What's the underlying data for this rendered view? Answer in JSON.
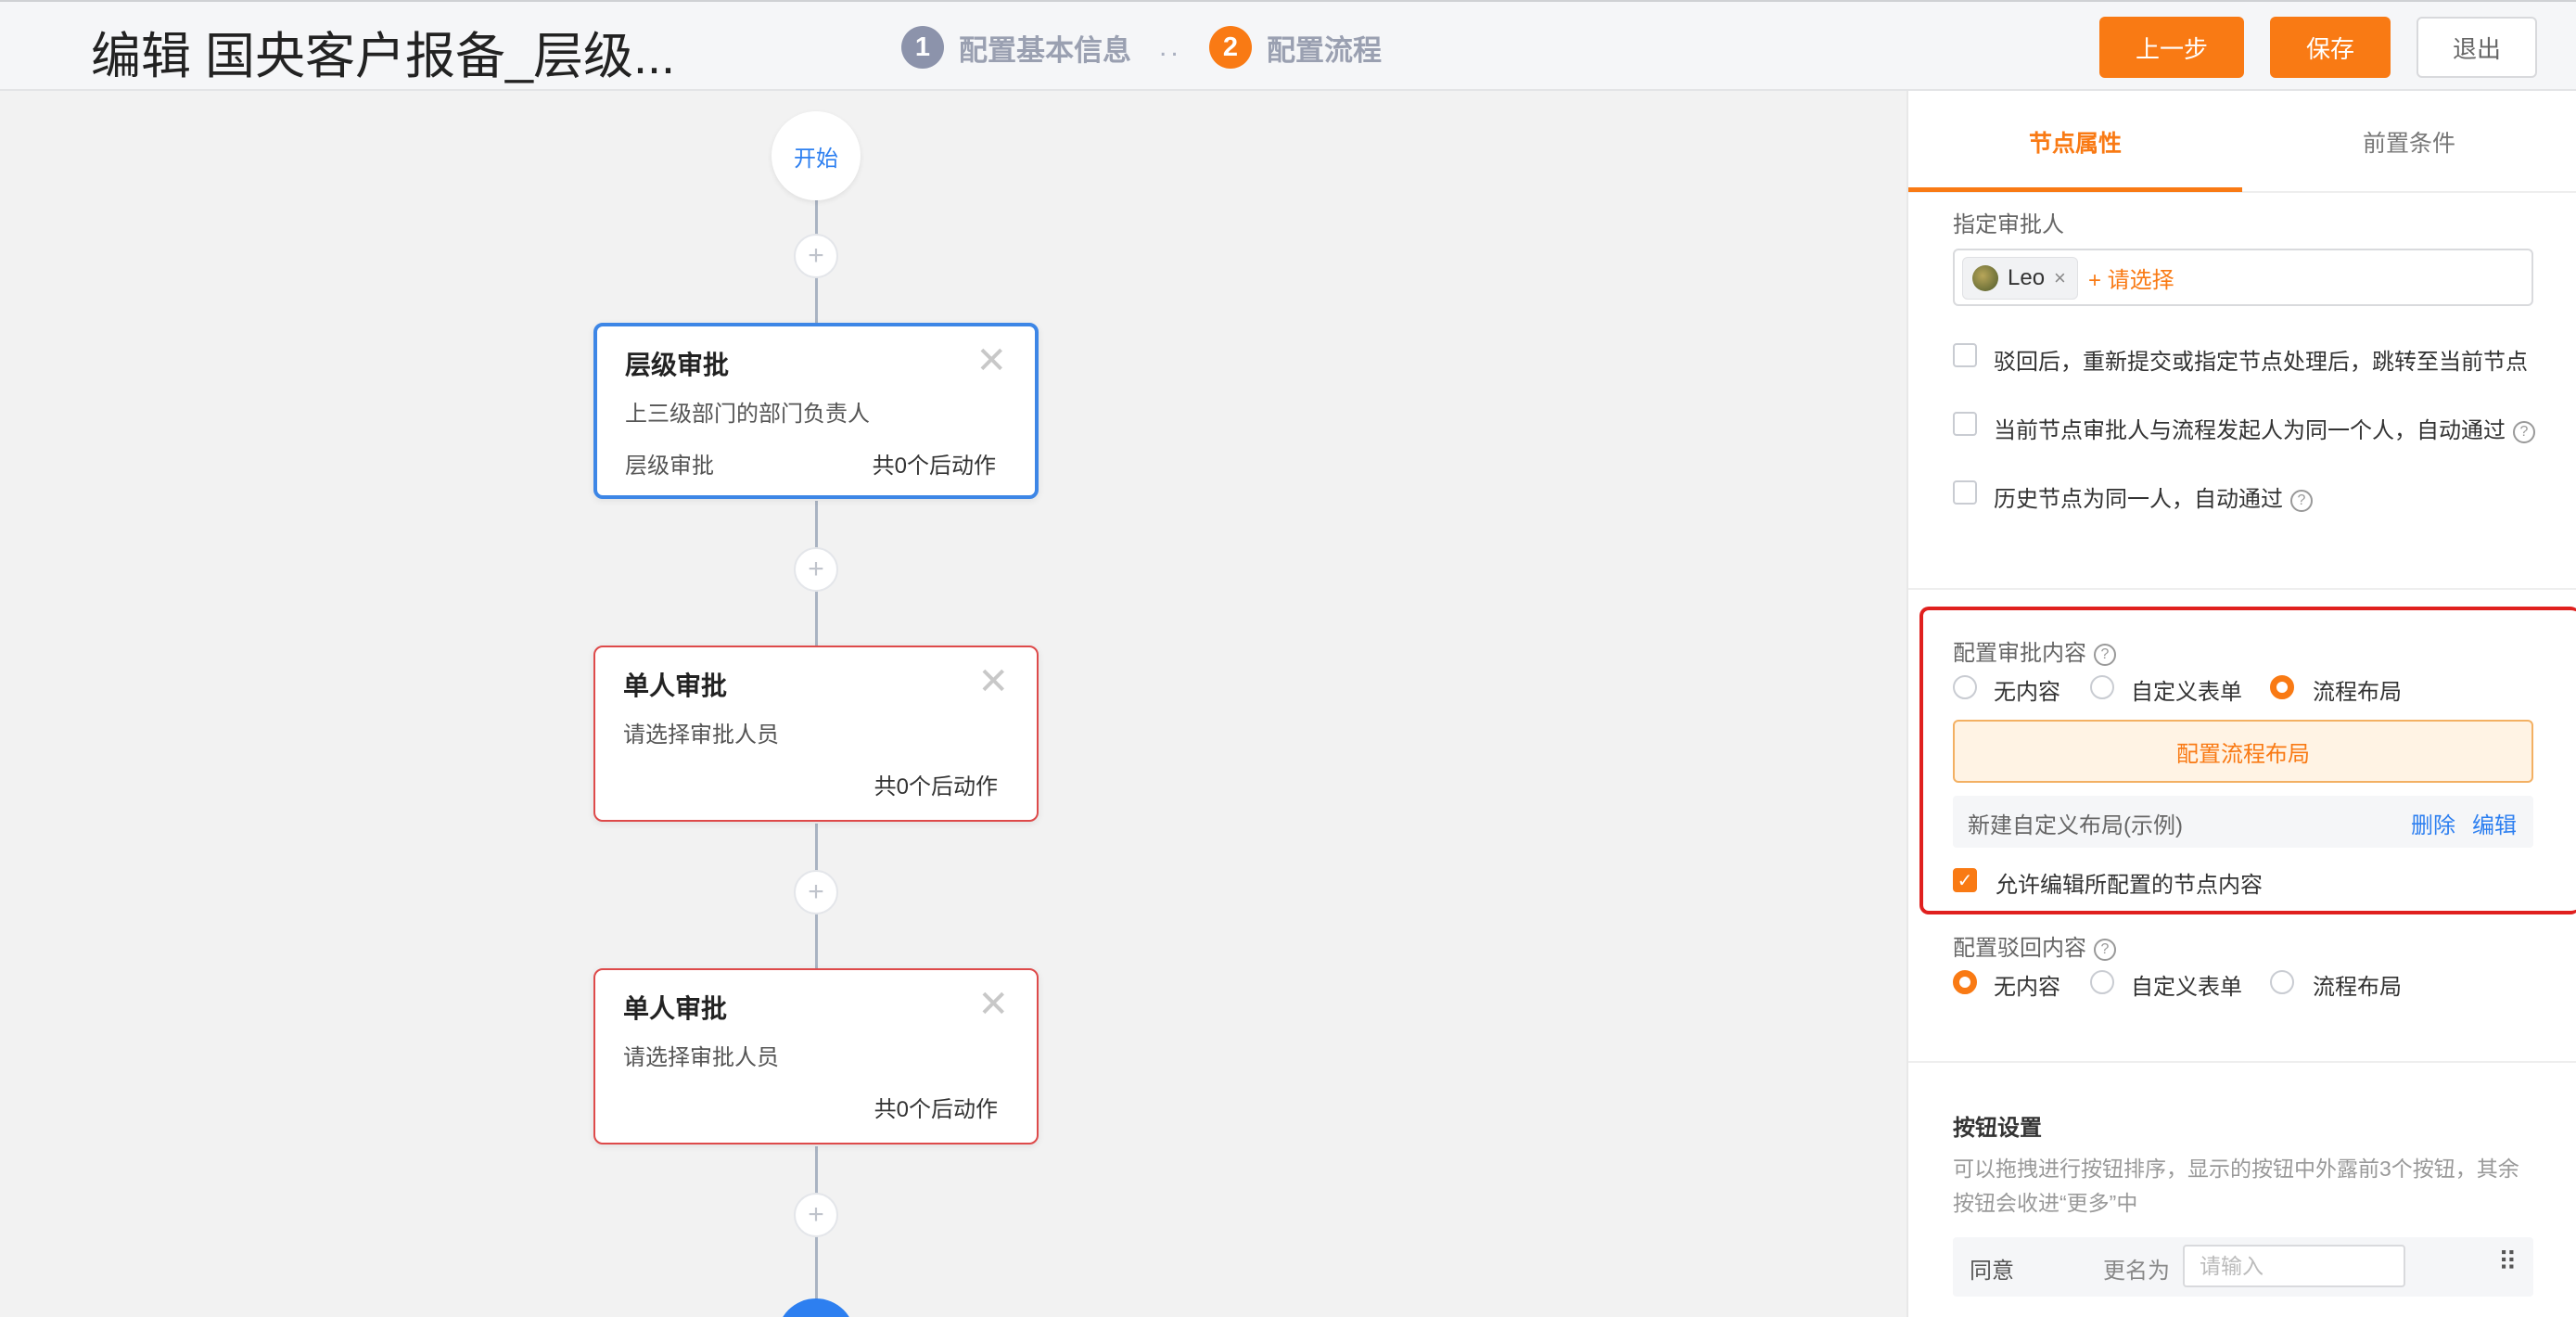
{
  "header": {
    "title": "编辑 国央客户报备_层级...",
    "steps": [
      {
        "num": "1",
        "label": "配置基本信息"
      },
      {
        "num": "2",
        "label": "配置流程"
      }
    ],
    "step_separator": "..",
    "buttons": {
      "prev": "上一步",
      "save": "保存",
      "exit": "退出"
    }
  },
  "flow": {
    "start_label": "开始",
    "plus_symbol": "+",
    "close_symbol": "✕",
    "nodes": [
      {
        "title": "层级审批",
        "desc": "上三级部门的部门负责人",
        "type": "层级审批",
        "actions": "共0个后动作"
      },
      {
        "title": "单人审批",
        "desc": "请选择审批人员",
        "type": "",
        "actions": "共0个后动作"
      },
      {
        "title": "单人审批",
        "desc": "请选择审批人员",
        "type": "",
        "actions": "共0个后动作"
      }
    ]
  },
  "panel": {
    "tabs": [
      "节点属性",
      "前置条件"
    ],
    "approver_label": "指定审批人",
    "approver_tag": "Leo",
    "approver_tag_remove": "×",
    "add_approver": "+ 请选择",
    "options": [
      {
        "label": "驳回后，重新提交或指定节点处理后，跳转至当前节点",
        "checked": false,
        "help": false
      },
      {
        "label": "当前节点审批人与流程发起人为同一个人，自动通过",
        "checked": false,
        "help": true
      },
      {
        "label": "历史节点为同一人，自动通过",
        "checked": false,
        "help": true
      }
    ],
    "help_symbol": "?",
    "approval_content": {
      "label": "配置审批内容",
      "radios": [
        "无内容",
        "自定义表单",
        "流程布局"
      ],
      "selected": "流程布局",
      "configure_button": "配置流程布局",
      "layout_name": "新建自定义布局(示例)",
      "delete": "删除",
      "edit": "编辑",
      "allow_edit_label": "允许编辑所配置的节点内容",
      "allow_edit_checked": true,
      "check_symbol": "✓"
    },
    "reject_content": {
      "label": "配置驳回内容",
      "radios": [
        "无内容",
        "自定义表单",
        "流程布局"
      ],
      "selected": "无内容"
    },
    "button_settings": {
      "title": "按钮设置",
      "desc": "可以拖拽进行按钮排序，显示的按钮中外露前3个按钮，其余按钮会收进“更多”中",
      "rows": [
        {
          "name": "同意",
          "rename_label": "更名为",
          "placeholder": "请输入"
        }
      ],
      "drag_symbol": "⠿"
    }
  },
  "colors": {
    "accent": "#f97a14",
    "link": "#2d7ff0",
    "selected_border": "#3d86e6",
    "error_border": "#de4a4a",
    "highlight": "#e0201e"
  }
}
